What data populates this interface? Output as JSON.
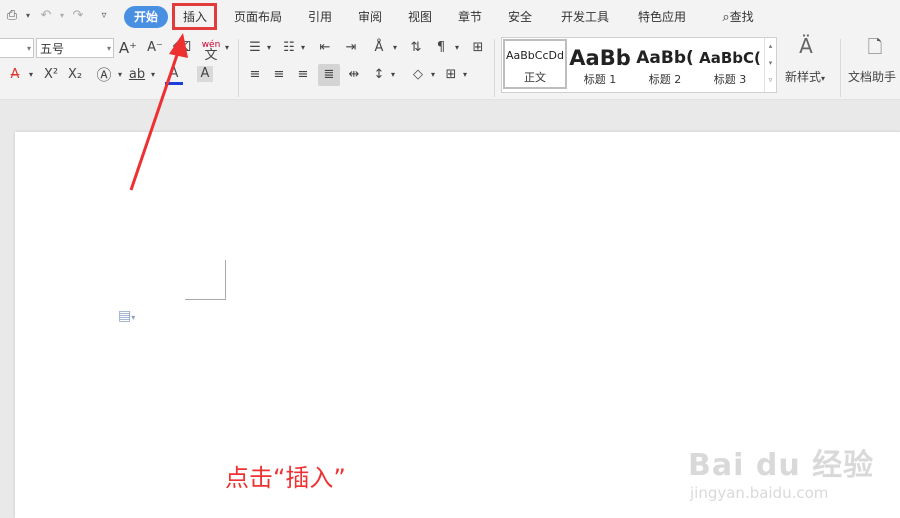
{
  "menu": {
    "tabs": [
      {
        "label": "开始"
      },
      {
        "label": "插入"
      },
      {
        "label": "页面布局"
      },
      {
        "label": "引用"
      },
      {
        "label": "审阅"
      },
      {
        "label": "视图"
      },
      {
        "label": "章节"
      },
      {
        "label": "安全"
      },
      {
        "label": "开发工具"
      },
      {
        "label": "特色应用"
      }
    ],
    "search_label": "查找"
  },
  "ribbon": {
    "font_size_value": "五号",
    "pinyin_label": "wén",
    "styles": [
      {
        "sample": "AaBbCcDd",
        "name": "正文"
      },
      {
        "sample": "AaBb",
        "name": "标题 1"
      },
      {
        "sample": "AaBb(",
        "name": "标题 2"
      },
      {
        "sample": "AaBbC(",
        "name": "标题 3"
      }
    ],
    "new_style_label": "新样式",
    "doc_assistant_label": "文档助手"
  },
  "annotation": {
    "callout_text": "点击“插入”"
  },
  "watermark": {
    "brand": "Bai du 经验",
    "url": "jingyan.baidu.com"
  }
}
